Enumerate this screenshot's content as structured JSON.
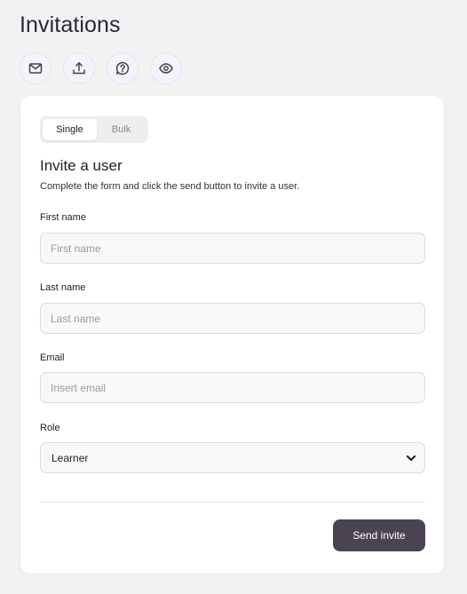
{
  "page": {
    "title": "Invitations"
  },
  "toolbar": {
    "icons": [
      "mail-icon",
      "upload-icon",
      "help-icon",
      "eye-icon"
    ]
  },
  "tabs": {
    "single": "Single",
    "bulk": "Bulk",
    "active": "Single"
  },
  "form": {
    "title": "Invite a user",
    "description": "Complete the form and click the send button to invite a user.",
    "first_name": {
      "label": "First name",
      "placeholder": "First name",
      "value": ""
    },
    "last_name": {
      "label": "Last name",
      "placeholder": "Last name",
      "value": ""
    },
    "email": {
      "label": "Email",
      "placeholder": "Insert email",
      "value": ""
    },
    "role": {
      "label": "Role",
      "value": "Learner"
    },
    "submit_label": "Send invite"
  },
  "colors": {
    "accent": "#4a4452",
    "icon_bg": "#f4f2fb",
    "page_bg": "#f2f2f2"
  }
}
